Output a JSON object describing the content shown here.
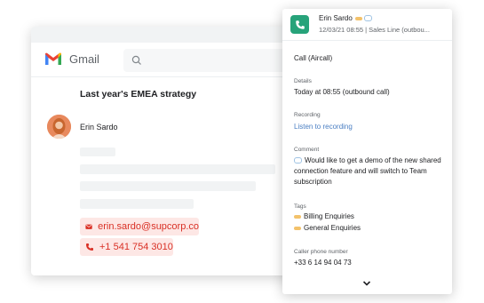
{
  "gmail": {
    "app_name": "Gmail",
    "subject": "Last year's EMEA strategy",
    "sender_name": "Erin Sardo",
    "email": "erin.sardo@supcorp.co",
    "phone": "+1 541 754 3010"
  },
  "aircall": {
    "contact_name": "Erin Sardo",
    "call_meta": "12/03/21 08:55 | Sales Line (outbou...",
    "call_title": "Call (Aircall)",
    "details_label": "Details",
    "details_value": "Today at 08:55 (outbound call)",
    "recording_label": "Recording",
    "recording_link": "Listen to recording",
    "comment_label": "Comment",
    "comment_value": "Would like to get a demo of the new shared connection feature and will switch to Team subscription",
    "tags_label": "Tags",
    "tags": [
      "Billing Enquiries",
      "General Enquiries"
    ],
    "caller_phone_label": "Caller phone number",
    "caller_phone": "+33 6 14 94 04 73"
  },
  "colors": {
    "aircall_green": "#27a37a",
    "chip_bg": "#fde7e5",
    "chip_text": "#d93025",
    "link": "#4b7fc3"
  },
  "icons": [
    "gmail-logo-icon",
    "search-icon",
    "mail-icon",
    "phone-icon",
    "phone-call-icon",
    "tag-icon",
    "chat-bubble-icon",
    "chevron-down-icon"
  ]
}
